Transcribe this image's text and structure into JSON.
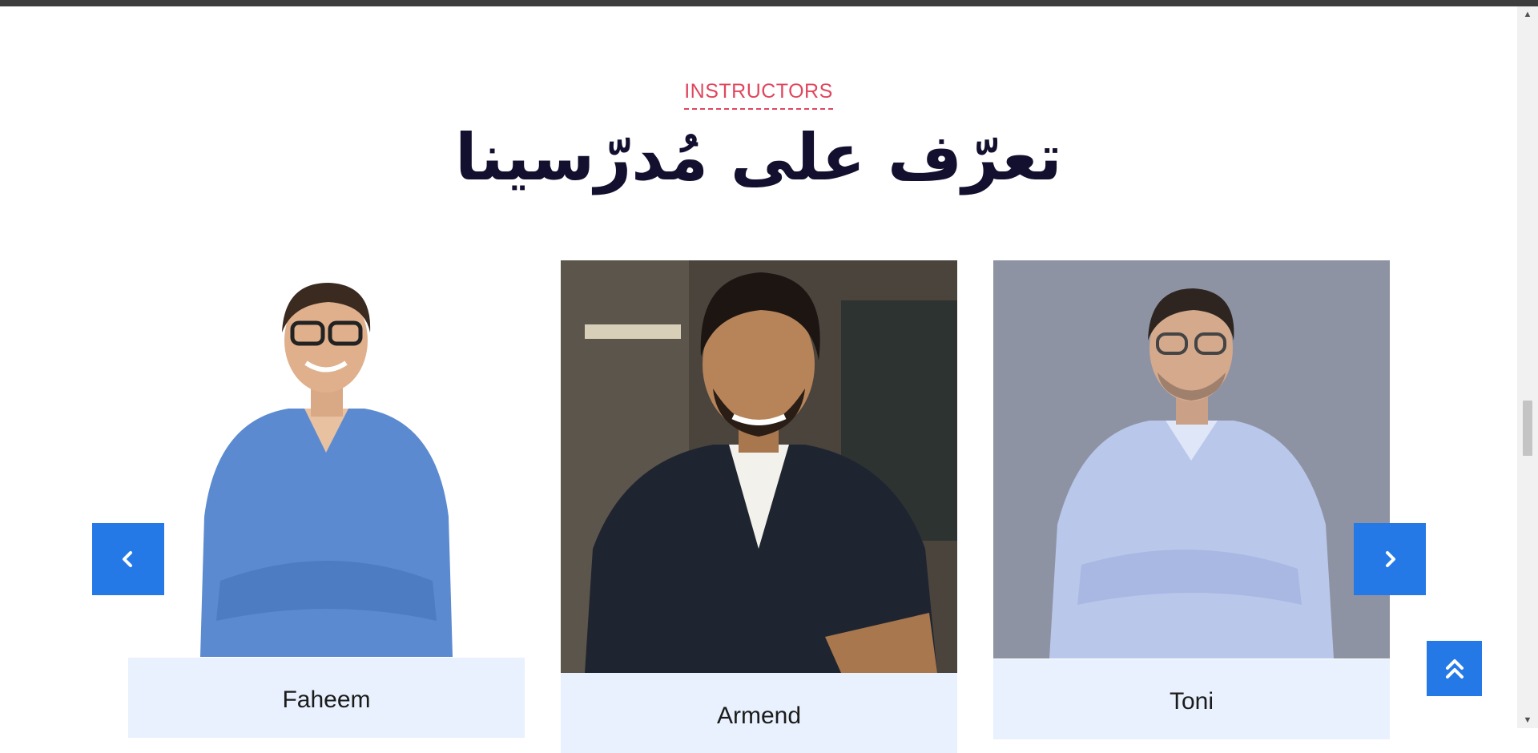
{
  "section": {
    "eyebrow": "INSTRUCTORS",
    "heading": "تعرّف على مُدرّسينا"
  },
  "instructors": [
    {
      "name": "Faheem",
      "photo_bg": "#ffffff",
      "shirt": "#5b8ad0"
    },
    {
      "name": "Armend",
      "photo_bg": "#4a443d",
      "shirt": "#1f2530"
    },
    {
      "name": "Toni",
      "photo_bg": "#8e93a4",
      "shirt": "#b9c7ea"
    }
  ],
  "controls": {
    "prev_icon": "chevron-left-icon",
    "next_icon": "chevron-right-icon",
    "scroll_top_icon": "double-chevron-up-icon"
  },
  "colors": {
    "accent": "#e0465e",
    "button": "#2579e6",
    "heading": "#12102e",
    "name_box": "#e8f1fd"
  }
}
